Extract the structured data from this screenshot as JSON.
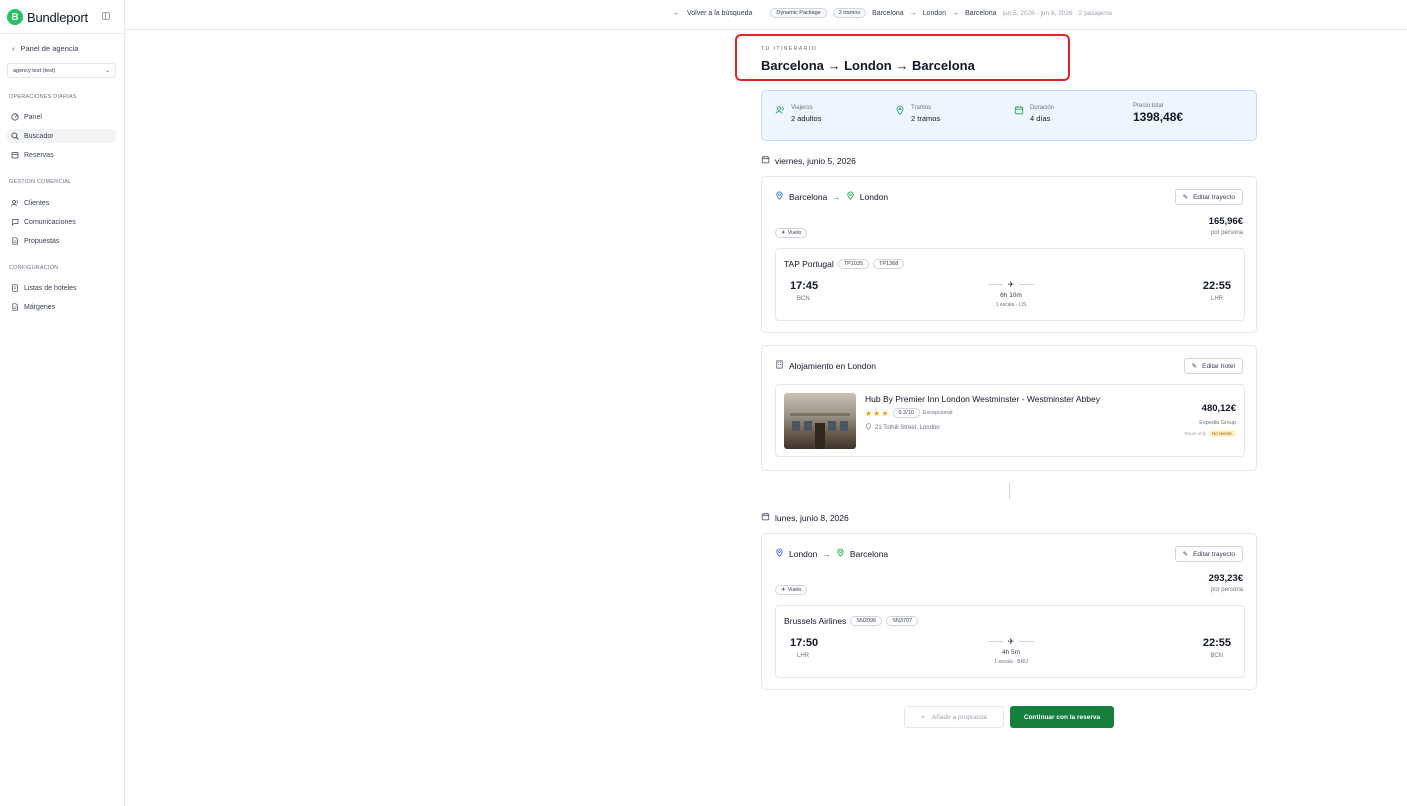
{
  "sidebar": {
    "brand": "Bundleport",
    "brand_logo": "B",
    "back_label": "Panel de agencia",
    "agency": "agency test (test)",
    "sections": {
      "daily": "OPERACIONES DIARIAS",
      "commercial": "GESTION COMERCIAL",
      "config": "CONFIGURACION"
    },
    "items": {
      "panel": "Panel",
      "buscador": "Buscador",
      "reservas": "Reservas",
      "clientes": "Clientes",
      "comunicaciones": "Comunicaciones",
      "propuestas": "Propuestas",
      "listas_hoteles": "Listas de hoteles",
      "margenes": "Márgenes"
    },
    "active_item": "Buscador"
  },
  "topbar": {
    "back": "Volver a la búsqueda",
    "package_pill": "Dynamic Package",
    "legs_pill": "2 tramos",
    "origin": "Barcelona",
    "stop": "London",
    "destination": "Barcelona",
    "dates": "jun 5, 2026 - jun 8, 2026",
    "passengers": "2 pasajeros"
  },
  "itinerary": {
    "label": "TU ITINERARIO",
    "title": "Barcelona → London → Barcelona"
  },
  "summary": {
    "travelers_label": "Viajeros",
    "travelers_value": "2 adultos",
    "legs_label": "Tramos",
    "legs_value": "2 tramos",
    "duration_label": "Duración",
    "duration_value": "4 días",
    "total_label": "Precio total",
    "total_value": "1398,48€"
  },
  "leg1": {
    "date": "viernes, junio 5, 2026",
    "from": "Barcelona",
    "to": "London",
    "edit_label": "Editar trayecto",
    "price": "165,96€",
    "per_person": "por persona",
    "type_badge": "Vuelo",
    "airline": "TAP Portugal",
    "codes": [
      "TP1035",
      "TP1368"
    ],
    "dep_time": "17:45",
    "dep_airport": "BCN",
    "arr_time": "22:55",
    "arr_airport": "LHR",
    "duration": "6h 10m",
    "stops": "1 escala · LIS"
  },
  "hotel": {
    "title": "Alojamiento en London",
    "edit_label": "Editar hotel",
    "name": "Hub By Premier Inn London Westminster - Westminster Abbey",
    "stars": "★★★",
    "score": "9.2/10",
    "score_label": "Excepcional",
    "address": "21 Tothill Street, London",
    "price": "480,12€",
    "provider": "Expedia Group",
    "board": "Room only",
    "refund": "No reemb."
  },
  "leg2": {
    "date": "lunes, junio 8, 2026",
    "from": "London",
    "to": "Barcelona",
    "edit_label": "Editar trayecto",
    "price": "293,23€",
    "per_person": "por persona",
    "type_badge": "Vuelo",
    "airline": "Brussels Airlines",
    "codes": [
      "SN2096",
      "SN3707"
    ],
    "dep_time": "17:50",
    "dep_airport": "LHR",
    "arr_time": "22:55",
    "arr_airport": "BCN",
    "duration": "4h 5m",
    "stops": "1 escala · BRU"
  },
  "actions": {
    "add_proposal": "Añadir a propuesta",
    "continue": "Continuar con la reserva"
  },
  "colors": {
    "brand_green": "#22c55e",
    "primary_button": "#15803d",
    "highlight_border": "#dc2626",
    "summary_bg": "#eff6ff"
  }
}
